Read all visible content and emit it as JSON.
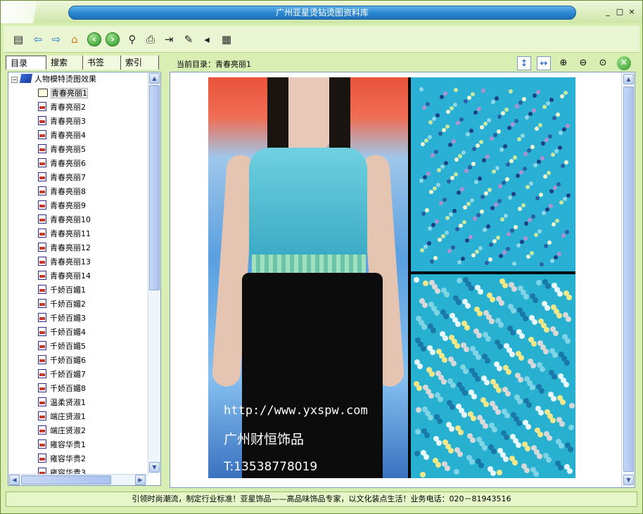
{
  "window": {
    "title": "广州亚星烫钻烫图资料库",
    "controls": [
      "_",
      "□",
      "×"
    ]
  },
  "toolbar": {
    "buttons": [
      {
        "name": "contents-icon",
        "glyph": "▤"
      },
      {
        "name": "back-arrow-icon",
        "glyph": "⇦"
      },
      {
        "name": "forward-arrow-icon",
        "glyph": "⇨"
      },
      {
        "name": "home-icon",
        "glyph": "⌂"
      },
      {
        "name": "prev-circle-icon",
        "glyph": "‹"
      },
      {
        "name": "next-circle-icon",
        "glyph": "›"
      },
      {
        "name": "find-binoculars-icon",
        "glyph": "⚲"
      },
      {
        "name": "print-icon",
        "glyph": "⎙"
      },
      {
        "name": "bookmark-add-icon",
        "glyph": "⇥"
      },
      {
        "name": "edit-icon",
        "glyph": "✎"
      },
      {
        "name": "sound-icon",
        "glyph": "◂"
      },
      {
        "name": "properties-icon",
        "glyph": "▦"
      }
    ]
  },
  "tabs": [
    "目录",
    "搜索",
    "书签",
    "索引"
  ],
  "tree": {
    "root": "人物模特烫图效果",
    "items": [
      "青春亮丽1",
      "青春亮丽2",
      "青春亮丽3",
      "青春亮丽4",
      "青春亮丽5",
      "青春亮丽6",
      "青春亮丽7",
      "青春亮丽8",
      "青春亮丽9",
      "青春亮丽10",
      "青春亮丽11",
      "青春亮丽12",
      "青春亮丽13",
      "青春亮丽14",
      "千娇百媚1",
      "千娇百媚2",
      "千娇百媚3",
      "千娇百媚4",
      "千娇百媚5",
      "千娇百媚6",
      "千娇百媚7",
      "千娇百媚8",
      "温柔贤淑1",
      "端庄贤淑1",
      "端庄贤淑2",
      "雍容华贵1",
      "雍容华贵2",
      "雍容华贵3"
    ],
    "selected_index": 0
  },
  "viewer": {
    "current_label": "当前目录：青春亮丽1",
    "tools": [
      {
        "name": "fit-height-icon",
        "glyph": "↕"
      },
      {
        "name": "fit-width-icon",
        "glyph": "↔"
      },
      {
        "name": "zoom-in-icon",
        "glyph": "⊕"
      },
      {
        "name": "zoom-out-icon",
        "glyph": "⊖"
      },
      {
        "name": "zoom-actual-icon",
        "glyph": "⊙"
      },
      {
        "name": "close-viewer-icon",
        "glyph": "✕"
      }
    ],
    "photo_text": {
      "url": "http://www.yxspw.com",
      "company": "广州财恒饰品",
      "phone": "T:13538778019"
    }
  },
  "status": "引领时尚潮流，制定行业标准！亚星饰品——高品味饰品专家，以文化装点生活！业务电话：020－81943516"
}
